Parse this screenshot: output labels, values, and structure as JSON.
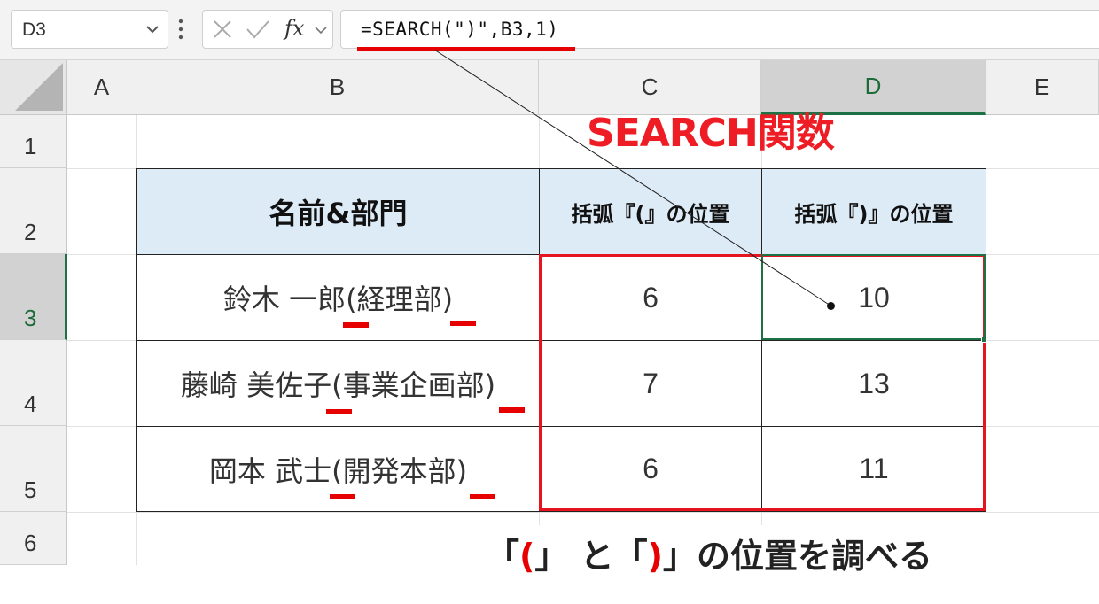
{
  "formula_bar": {
    "name_box": "D3",
    "fx_label": "fx",
    "formula": "=SEARCH(\")\",B3,1)"
  },
  "columns": [
    "A",
    "B",
    "C",
    "D",
    "E"
  ],
  "rows": [
    "1",
    "2",
    "3",
    "4",
    "5",
    "6"
  ],
  "selected": {
    "column": "D",
    "row": "3"
  },
  "table": {
    "headers": [
      "名前&部門",
      "括弧『(』の位置",
      "括弧『)』の位置"
    ],
    "rows": [
      {
        "name": "鈴木 一郎(経理部)",
        "open_pos": "6",
        "close_pos": "10"
      },
      {
        "name": "藤崎 美佐子(事業企画部)",
        "open_pos": "7",
        "close_pos": "13"
      },
      {
        "name": "岡本 武士(開発本部)",
        "open_pos": "6",
        "close_pos": "11"
      }
    ]
  },
  "annotations": {
    "function_title": "SEARCH関数",
    "caption_pre": "「",
    "caption_open": "(",
    "caption_mid": "」 と「",
    "caption_close": ")",
    "caption_post": "」の位置を調べる"
  },
  "colors": {
    "accent_red": "#e60000",
    "header_fill": "#ddebf7",
    "excel_green": "#1e7145"
  },
  "icons": [
    "chevron-down-icon",
    "more-vertical-icon",
    "cancel-icon",
    "enter-check-icon",
    "function-icon",
    "select-all-icon"
  ]
}
